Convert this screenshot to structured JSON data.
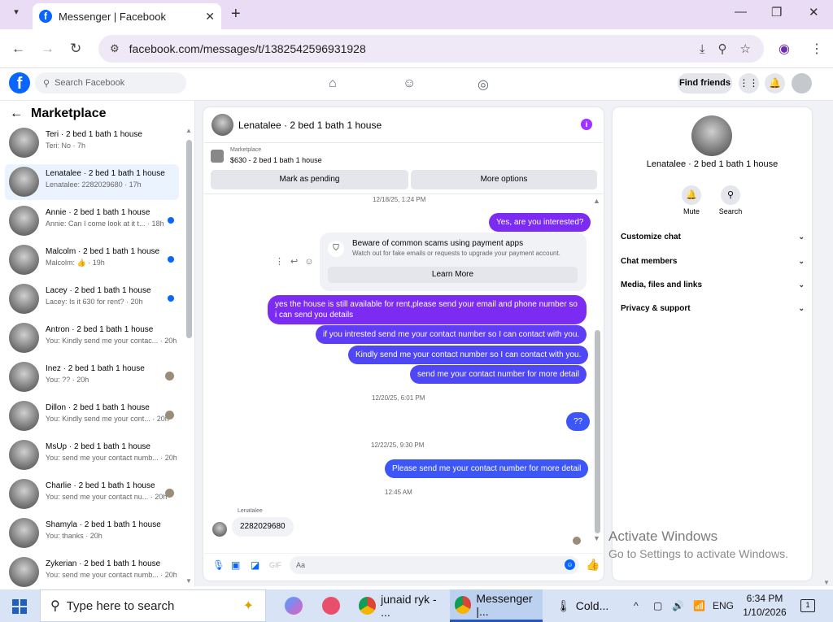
{
  "browser": {
    "tab_title": "Messenger | Facebook",
    "url": "facebook.com/messages/t/1382542596931928"
  },
  "fb": {
    "search_placeholder": "Search Facebook",
    "find_friends": "Find friends"
  },
  "left": {
    "heading": "Marketplace",
    "items": [
      {
        "name": "Teri · 2 bed 1 bath 1 house",
        "preview": "Teri: No · 7h",
        "indicator": "none"
      },
      {
        "name": "Lenatalee · 2 bed 1 bath 1 house",
        "preview": "Lenatalee: 2282029680 · 17h",
        "indicator": "none"
      },
      {
        "name": "Annie · 2 bed 1 bath 1 house",
        "preview": "Annie: Can I come look at it t... · 18h",
        "indicator": "unread"
      },
      {
        "name": "Malcolm · 2 bed 1 bath 1 house",
        "preview": "Malcolm: 👍 · 19h",
        "indicator": "unread"
      },
      {
        "name": "Lacey · 2 bed 1 bath 1 house",
        "preview": "Lacey: Is it 630 for rent? · 20h",
        "indicator": "unread"
      },
      {
        "name": "Antron · 2 bed 1 bath 1 house",
        "preview": "You: Kindly send me your contac... · 20h",
        "indicator": "none"
      },
      {
        "name": "Inez · 2 bed 1 bath 1 house",
        "preview": "You: ?? · 20h",
        "indicator": "seen"
      },
      {
        "name": "Dillon · 2 bed 1 bath 1 house",
        "preview": "You: Kindly send me your cont... · 20h",
        "indicator": "seen"
      },
      {
        "name": "MsUp · 2 bed 1 bath 1 house",
        "preview": "You: send me your contact numb... · 20h",
        "indicator": "none"
      },
      {
        "name": "Charlie · 2 bed 1 bath 1 house",
        "preview": "You: send me your contact nu... · 20h",
        "indicator": "seen"
      },
      {
        "name": "Shamyla · 2 bed 1 bath 1 house",
        "preview": "You: thanks · 20h",
        "indicator": "none"
      },
      {
        "name": "Zykerian · 2 bed 1 bath 1 house",
        "preview": "You: send me your contact numb... · 20h",
        "indicator": "none"
      }
    ]
  },
  "chat": {
    "title": "Lenatalee · 2 bed 1 bath 1 house",
    "marketplace_label": "Marketplace",
    "listing": "$630 - 2 bed 1 bath 1 house",
    "mark_pending": "Mark as pending",
    "more_options": "More options",
    "ts1": "12/18/25, 1:24 PM",
    "msg1": "Yes, are you interested?",
    "warn_title": "Beware of common scams using payment apps",
    "warn_sub": "Watch out for fake emails or requests to upgrade your payment account.",
    "learn_more": "Learn More",
    "msg2": "yes the house is still available for rent,please send your email and phone number so i can send you details",
    "msg3": "if you intrested send me your contact number so I can contact with you.",
    "msg4": "Kindly send me your contact number so I can contact with you.",
    "msg5": "send me your contact number for more detail",
    "ts2": "12/20/25, 6:01 PM",
    "msg6": "??",
    "ts3": "12/22/25, 9:30 PM",
    "msg7": "Please send me your contact number for more detail",
    "ts4": "12:45 AM",
    "recv_name": "Lenatalee",
    "recv_msg": "2282029680",
    "input_placeholder": "Aa"
  },
  "right": {
    "name": "Lenatalee · 2 bed 1 bath 1 house",
    "mute": "Mute",
    "search": "Search",
    "rows": [
      "Customize chat",
      "Chat members",
      "Media, files and links",
      "Privacy & support"
    ]
  },
  "watermark": {
    "line1": "Activate Windows",
    "line2": "Go to Settings to activate Windows."
  },
  "taskbar": {
    "search": "Type here to search",
    "app1": "junaid ryk - ...",
    "app2": "Messenger |...",
    "weather": "Cold...",
    "lang": "ENG",
    "time": "6:34 PM",
    "date": "1/10/2026",
    "notif_count": "1"
  },
  "colors": {
    "accent": "#0866ff",
    "bubble": "#7b2bf2",
    "selected_row": "#ebf3ff"
  }
}
